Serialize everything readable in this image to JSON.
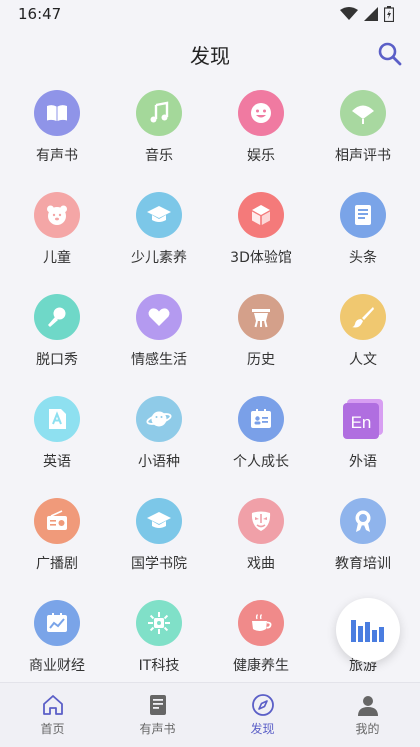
{
  "status": {
    "time": "16:47"
  },
  "header": {
    "title": "发现"
  },
  "categories": [
    {
      "label": "有声书",
      "icon": "book-icon",
      "color": "#8f94e8"
    },
    {
      "label": "音乐",
      "icon": "music-note-icon",
      "color": "#a4d89a"
    },
    {
      "label": "娱乐",
      "icon": "smiley-face-icon",
      "color": "#f07aa1"
    },
    {
      "label": "相声评书",
      "icon": "fan-icon",
      "color": "#a8d8a0"
    },
    {
      "label": "儿童",
      "icon": "bear-icon",
      "color": "#f4a6a6"
    },
    {
      "label": "少儿素养",
      "icon": "graduation-cap-icon",
      "color": "#7cc7e8"
    },
    {
      "label": "3D体验馆",
      "icon": "cube-icon",
      "color": "#f47a7a"
    },
    {
      "label": "头条",
      "icon": "newspaper-icon",
      "color": "#7aa4e8"
    },
    {
      "label": "脱口秀",
      "icon": "microphone-icon",
      "color": "#6fd8c8"
    },
    {
      "label": "情感生活",
      "icon": "heart-icon",
      "color": "#b49af0"
    },
    {
      "label": "历史",
      "icon": "ancient-vessel-icon",
      "color": "#d4a08a"
    },
    {
      "label": "人文",
      "icon": "brush-icon",
      "color": "#f0c870"
    },
    {
      "label": "英语",
      "icon": "letter-a-icon",
      "color": "#8ee0f0"
    },
    {
      "label": "小语种",
      "icon": "planet-icon",
      "color": "#8fcbe8"
    },
    {
      "label": "个人成长",
      "icon": "id-card-icon",
      "color": "#7aa0e8"
    },
    {
      "label": "外语",
      "icon": "en-badge-icon",
      "color": "#b06ee0"
    },
    {
      "label": "广播剧",
      "icon": "radio-icon",
      "color": "#f09a7a"
    },
    {
      "label": "国学书院",
      "icon": "graduation-cap-icon",
      "color": "#7cc7e8"
    },
    {
      "label": "戏曲",
      "icon": "opera-mask-icon",
      "color": "#f0a0a8"
    },
    {
      "label": "教育培训",
      "icon": "award-icon",
      "color": "#8fb4ec"
    },
    {
      "label": "商业财经",
      "icon": "chart-board-icon",
      "color": "#7aa4e8"
    },
    {
      "label": "IT科技",
      "icon": "chip-icon",
      "color": "#80e0c8"
    },
    {
      "label": "健康养生",
      "icon": "tea-cup-icon",
      "color": "#f08a8a"
    },
    {
      "label": "旅游",
      "icon": "travel-icon",
      "color": "#e8e8e8"
    }
  ],
  "tabbar": [
    {
      "label": "首页",
      "icon": "home-icon"
    },
    {
      "label": "有声书",
      "icon": "document-icon"
    },
    {
      "label": "发现",
      "icon": "compass-icon",
      "active": true
    },
    {
      "label": "我的",
      "icon": "person-icon"
    }
  ],
  "colors": {
    "accent": "#5b5fc7",
    "inactive": "#666666"
  }
}
